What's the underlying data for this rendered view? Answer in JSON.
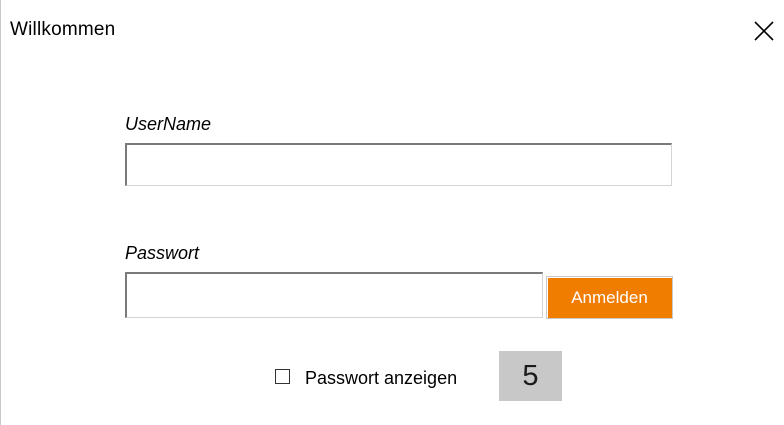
{
  "window": {
    "title": "Willkommen"
  },
  "form": {
    "username_label": "UserName",
    "username_value": "",
    "password_label": "Passwort",
    "password_value": "",
    "login_label": "Anmelden",
    "show_password_label": "Passwort anzeigen",
    "show_password_checked": false,
    "counter_value": "5"
  },
  "icons": {
    "close": "close-icon"
  },
  "colors": {
    "login_button_bg": "#f07c00",
    "counter_bg": "#c8c8c8"
  }
}
